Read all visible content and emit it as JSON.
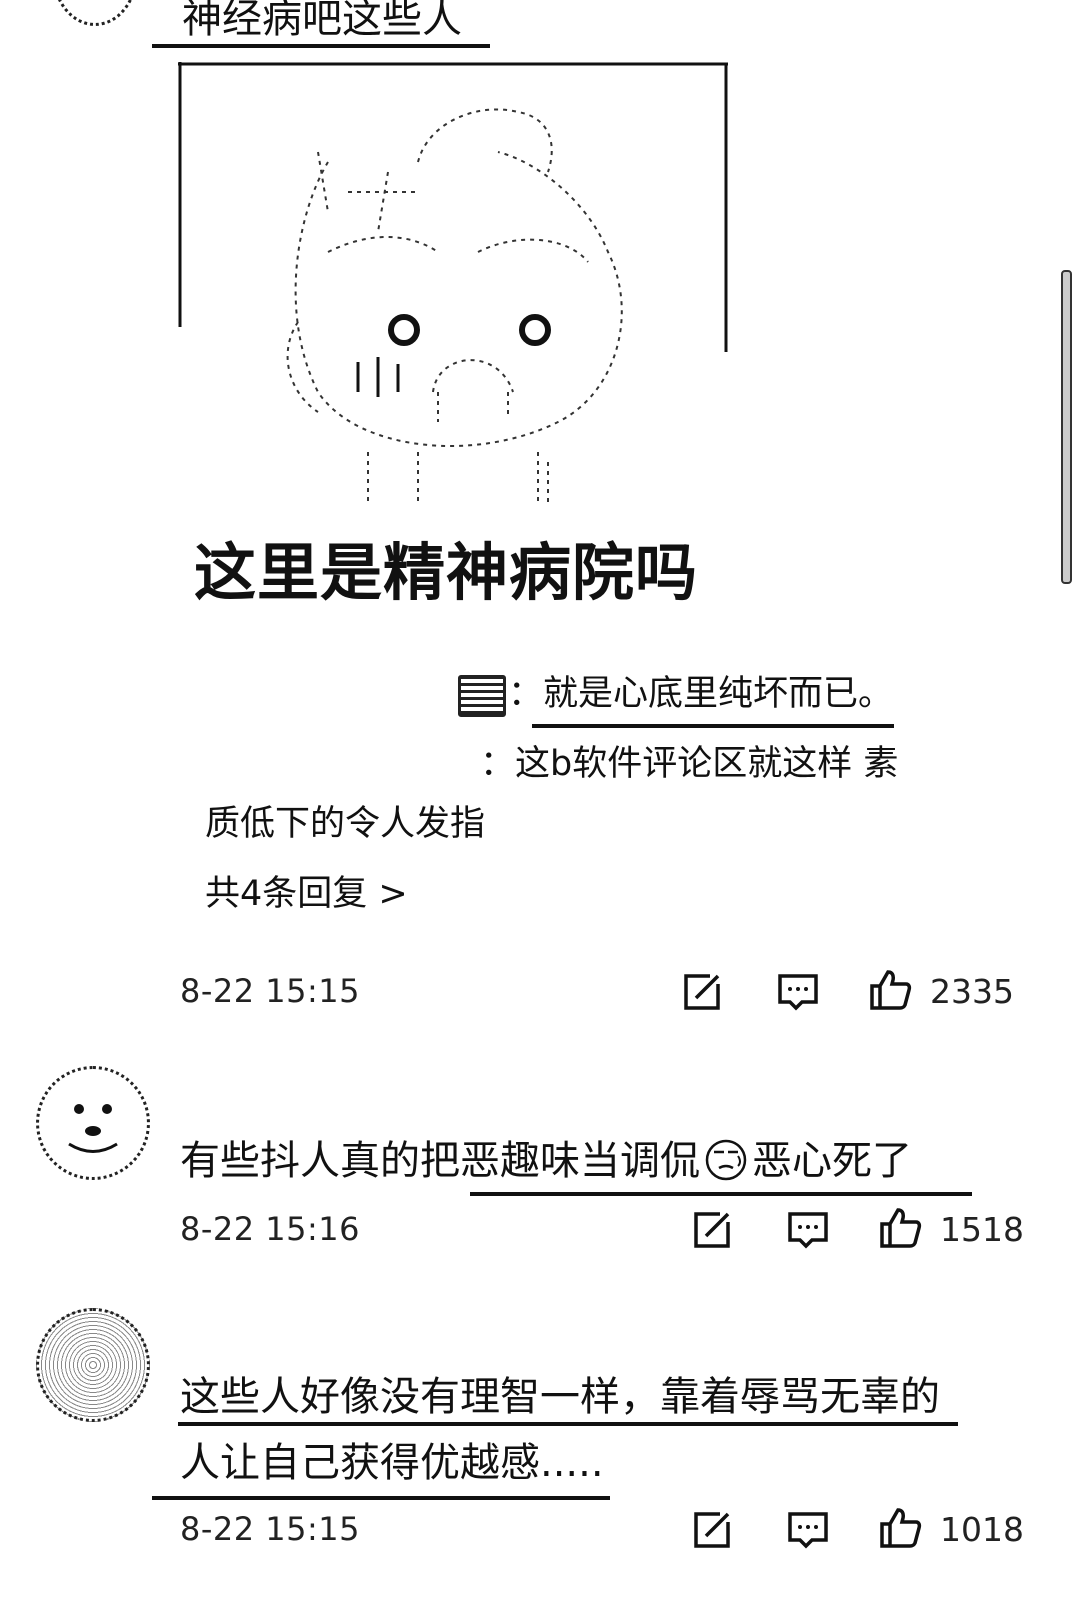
{
  "comments": [
    {
      "text": "神经病吧这些人",
      "meme_caption": "这里是精神病院吗",
      "replies": [
        {
          "user_icon": "sticker-icon",
          "text": "：就是心底里纯坏而已。"
        },
        {
          "text_line1": "：这b软件评论区就这样 素",
          "text_line2": "质低下的令人发指"
        }
      ],
      "more_replies": "共4条回复 >",
      "time": "8-22 15:15",
      "likes": "2335"
    },
    {
      "text_part1": "有些抖人真的把恶趣味当调侃",
      "emoji": "sweat-face-emoji",
      "text_part2": "恶心死了",
      "time": "8-22 15:16",
      "likes": "1518"
    },
    {
      "text_line1": "这些人好像没有理智一样，靠着辱骂无辜的",
      "text_line2": "人让自己获得优越感.....",
      "time": "8-22 15:15",
      "likes": "1018"
    }
  ]
}
